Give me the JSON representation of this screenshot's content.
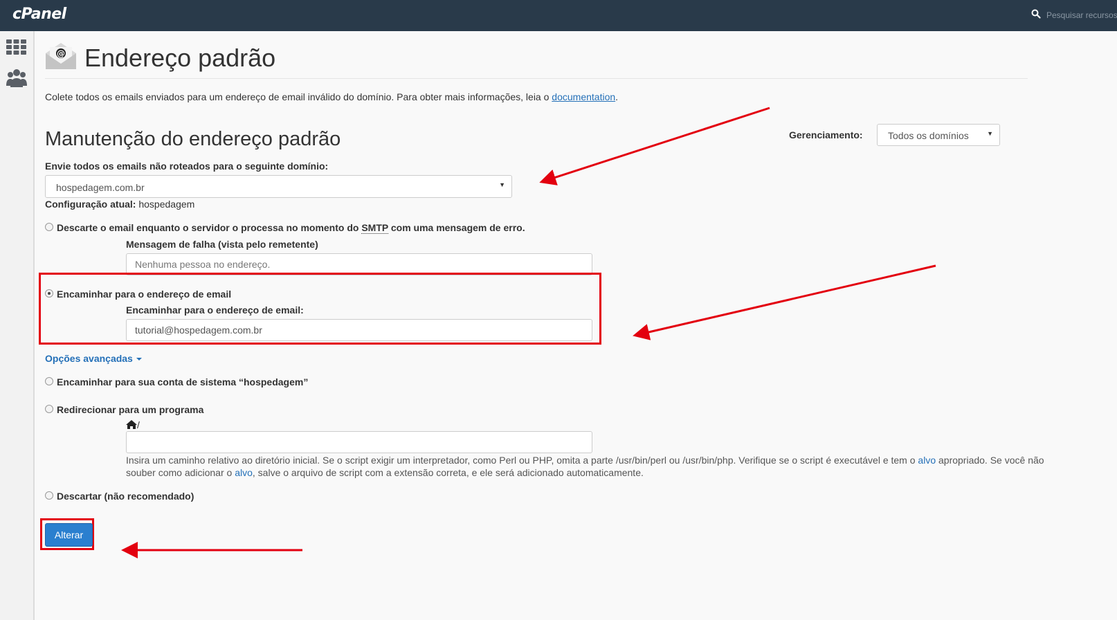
{
  "topbar": {
    "logo_text": "cPanel",
    "search_placeholder": "Pesquisar recursos"
  },
  "sidebar": {
    "items": [
      {
        "icon": "grid-icon",
        "label": "Home"
      },
      {
        "icon": "users-icon",
        "label": "Users"
      }
    ]
  },
  "page": {
    "title": "Endereço padrão",
    "intro": "Colete todos os emails enviados para um endereço de email inválido do domínio. Para obter mais informações, leia o",
    "intro_link": "documentation",
    "intro_end": "."
  },
  "maintenance": {
    "title": "Manutenção do endereço padrão",
    "management_label": "Gerenciamento:",
    "management_value": "Todos os domínios",
    "domain_label": "Envie todos os emails não roteados para o seguinte domínio:",
    "domain_value": "hospedagem.com.br",
    "current_label": "Configuração atual:",
    "current_value": " hospedagem"
  },
  "options": {
    "discard_smtp": {
      "label_before": "Descarte o email enquanto o servidor o processa no momento do ",
      "label_abbr": "SMTP",
      "label_after": " com uma mensagem de erro.",
      "field_label": "Mensagem de falha (vista pelo remetente)",
      "placeholder": "Nenhuma pessoa no endereço.",
      "checked": false
    },
    "forward_email": {
      "label": "Encaminhar para o endereço de email",
      "field_label": "Encaminhar para o endereço de email:",
      "value": "tutorial@hospedagem.com.br",
      "checked": true
    },
    "advanced_label": "Opções avançadas",
    "forward_system": {
      "label": "Encaminhar para sua conta de sistema “hospedagem”",
      "checked": false
    },
    "pipe_program": {
      "label": "Redirecionar para um programa",
      "home_suffix": "/",
      "value": "",
      "help_1": "Insira um caminho relativo ao diretório inicial. Se o script exigir um interpretador, como Perl ou PHP, omita a parte /usr/bin/perl ou /usr/bin/php. Verifique se o script é executável e tem o ",
      "help_link1": "alvo",
      "help_2": " apropriado. Se você não souber como adicionar o ",
      "help_link2": "alvo",
      "help_3": ", salve o arquivo de script com a extensão correta, e ele será adicionado automaticamente.",
      "checked": false
    },
    "blackhole": {
      "label": "Descartar (não recomendado)",
      "checked": false
    }
  },
  "submit_label": "Alterar",
  "annotation_color": "#e3000f"
}
